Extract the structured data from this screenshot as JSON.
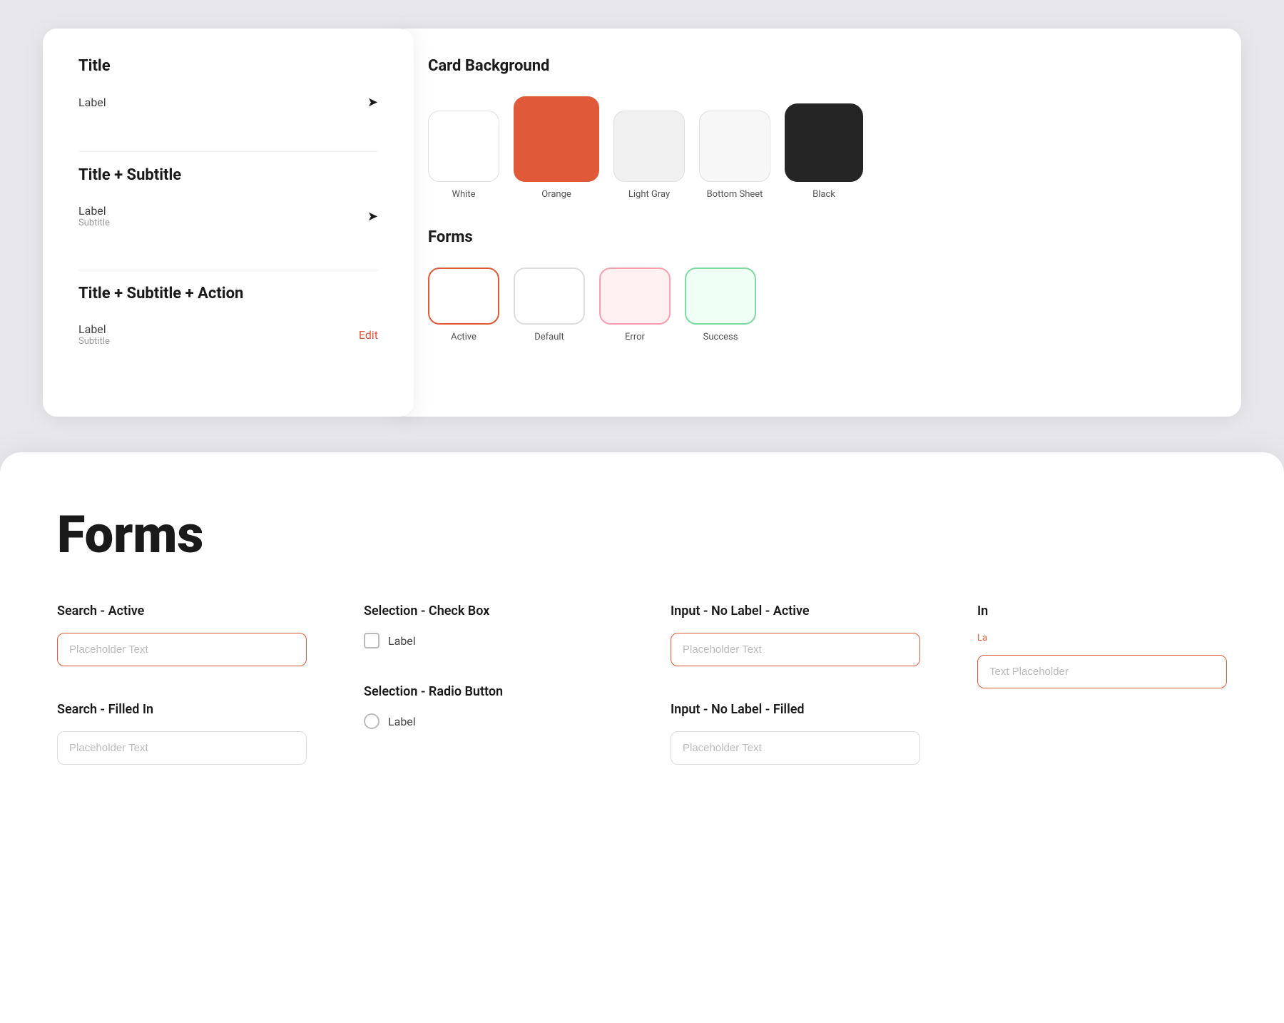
{
  "listCard": {
    "section1": {
      "title": "Title",
      "label": "Label",
      "icon": "➤"
    },
    "section2": {
      "title": "Title + Subtitle",
      "label": "Label",
      "subtitle": "Subtitle",
      "icon": "➤"
    },
    "section3": {
      "title": "Title + Subtitle + Action",
      "label": "Label",
      "subtitle": "Subtitle",
      "action": "Edit"
    }
  },
  "cardBackground": {
    "sectionTitle": "Card Background",
    "swatches": [
      {
        "id": "white",
        "label": "White",
        "class": "swatch-white"
      },
      {
        "id": "orange",
        "label": "Orange",
        "class": "swatch-orange"
      },
      {
        "id": "lightgray",
        "label": "Light Gray",
        "class": "swatch-lightgray"
      },
      {
        "id": "bottomsheet",
        "label": "Bottom Sheet",
        "class": "swatch-bottomsheet"
      },
      {
        "id": "black",
        "label": "Black",
        "class": "swatch-black"
      }
    ]
  },
  "formsSection": {
    "sectionTitle": "Forms",
    "swatches": [
      {
        "id": "active",
        "label": "Active",
        "class": "form-swatch-active"
      },
      {
        "id": "default",
        "label": "Default",
        "class": "form-swatch-default"
      },
      {
        "id": "error",
        "label": "Error",
        "class": "form-swatch-error"
      },
      {
        "id": "success",
        "label": "Success",
        "class": "form-swatch-success"
      }
    ]
  },
  "formsPage": {
    "pageTitle": "Forms",
    "searchActive": {
      "title": "Search - Active",
      "placeholder": "Placeholder Text"
    },
    "searchFilledIn": {
      "title": "Search - Filled In",
      "placeholder": "Placeholder Text"
    },
    "selectionCheckBox": {
      "title": "Selection - Check Box",
      "label": "Label"
    },
    "selectionRadioButton": {
      "title": "Selection - Radio Button",
      "label": "Label"
    },
    "inputNoLabelActive": {
      "title": "Input - No Label - Active",
      "placeholder": "Placeholder Text"
    },
    "inputNoLabelFilled": {
      "title": "Input - No Label - Filled",
      "placeholder": "Placeholder Text"
    },
    "partialInput": {
      "title": "In",
      "labelText": "La",
      "placeholder": "Text Placeholder"
    }
  }
}
